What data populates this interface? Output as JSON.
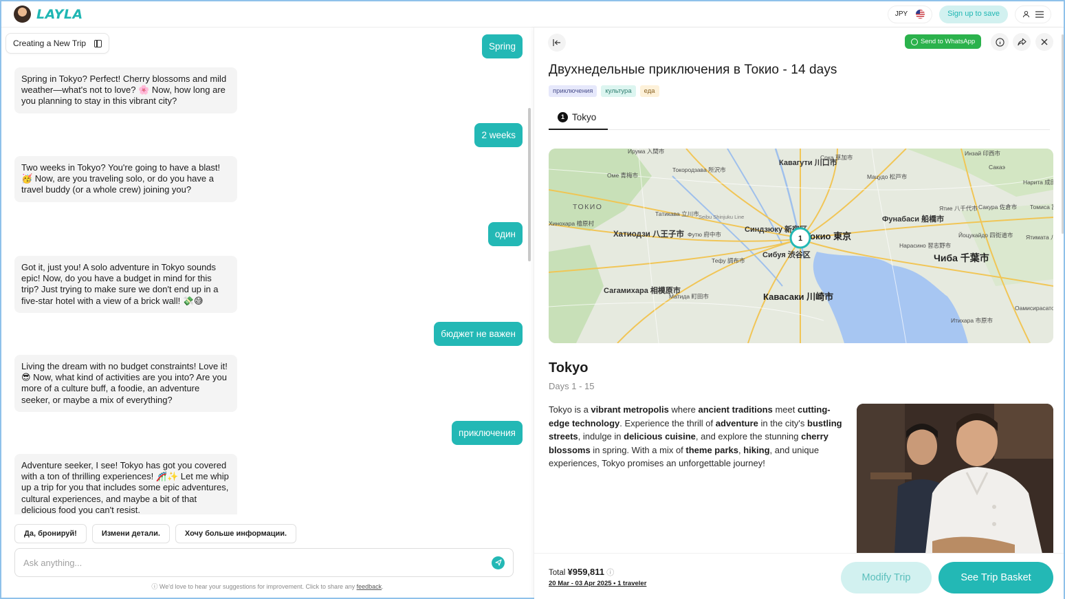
{
  "header": {
    "brand": "LAYLA",
    "currency": "JPY",
    "signup_label": "Sign up to save"
  },
  "chat": {
    "trip_chip_label": "Creating a New Trip",
    "messages": [
      {
        "role": "user",
        "text": "Spring"
      },
      {
        "role": "bot",
        "text": "Spring in Tokyo? Perfect! Cherry blossoms and mild weather—what's not to love? 🌸 Now, how long are you planning to stay in this vibrant city?"
      },
      {
        "role": "user",
        "text": "2 weeks"
      },
      {
        "role": "bot",
        "text": "Two weeks in Tokyo? You're going to have a blast! 🥳 Now, are you traveling solo, or do you have a travel buddy (or a whole crew) joining you?"
      },
      {
        "role": "user",
        "text": "один"
      },
      {
        "role": "bot",
        "text": "Got it, just you! A solo adventure in Tokyo sounds epic! Now, do you have a budget in mind for this trip? Just trying to make sure we don't end up in a five-star hotel with a view of a brick wall! 💸😅"
      },
      {
        "role": "user",
        "text": "бюджет не важен"
      },
      {
        "role": "bot",
        "text": "Living the dream with no budget constraints! Love it! 😎 Now, what kind of activities are you into? Are you more of a culture buff, a foodie, an adventure seeker, or maybe a mix of everything?"
      },
      {
        "role": "user",
        "text": "приключения"
      },
      {
        "role": "bot",
        "text": "Adventure seeker, I see! Tokyo has got you covered with a ton of thrilling experiences! 🎢✨ Let me whip up a trip for you that includes some epic adventures, cultural experiences, and maybe a bit of that delicious food you can't resist."
      }
    ],
    "suggestions": [
      "Да, бронируй!",
      "Измени детали.",
      "Хочу больше информации."
    ],
    "input_placeholder": "Ask anything...",
    "feedback_text": "We'd love to hear your suggestions for improvement. Click to share any",
    "feedback_link": "feedback",
    "feedback_end": "."
  },
  "trip": {
    "whatsapp_label": "Send to WhatsApp",
    "title": "Двухнедельные приключения в Токио - 14 days",
    "tags": [
      {
        "label": "приключения",
        "bg": "#e6e8fb",
        "color": "#4a4f8c"
      },
      {
        "label": "культура",
        "bg": "#dcf5f0",
        "color": "#2c7d6e"
      },
      {
        "label": "еда",
        "bg": "#fdf1d9",
        "color": "#8a6322"
      }
    ],
    "tab_number": "1",
    "tab_label": "Tokyo",
    "map_pin_number": "1",
    "map_labels": [
      "Ирума 入間市",
      "Кавагути 川口市",
      "Сока 草加市",
      "Инзай 印西市",
      "Оме 青梅市",
      "Токородзава 所沢市",
      "Мацудо 松戸市",
      "Сакаэ",
      "Нарита 成田市",
      "ТОКИО",
      "Татикава 立川市",
      "Seibu Shinjuku Line",
      "Фунабаси 船橋市",
      "Ятие 八千代市",
      "Сакура 佐倉市",
      "Томиса 富里市",
      "Хинохара 檜原村",
      "Хатиодзи 八王子市",
      "Футю 府中市",
      "Синдзюку 新宿区",
      "Токио 東京",
      "Нарасино 習志野市",
      "Йоцукайдо 四街道市",
      "Ятимата 八街市",
      "Сибуя 渋谷区",
      "Тефу 調布市",
      "Чиба 千葉市",
      "Сагамихара 相模原市",
      "Матида 町田市",
      "Кавасаки 川崎市",
      "Итихара 市原市",
      "Оамисирасато 大網白里市"
    ],
    "city": "Tokyo",
    "days": "Days 1 - 15",
    "description_parts": [
      {
        "t": "Tokyo is a ",
        "b": false
      },
      {
        "t": "vibrant metropolis",
        "b": true
      },
      {
        "t": " where ",
        "b": false
      },
      {
        "t": "ancient traditions",
        "b": true
      },
      {
        "t": " meet ",
        "b": false
      },
      {
        "t": "cutting-edge technology",
        "b": true
      },
      {
        "t": ". Experience the thrill of ",
        "b": false
      },
      {
        "t": "adventure",
        "b": true
      },
      {
        "t": " in the city's ",
        "b": false
      },
      {
        "t": "bustling streets",
        "b": true
      },
      {
        "t": ", indulge in ",
        "b": false
      },
      {
        "t": "delicious cuisine",
        "b": true
      },
      {
        "t": ", and explore the stunning ",
        "b": false
      },
      {
        "t": "cherry blossoms",
        "b": true
      },
      {
        "t": " in spring. With a mix of ",
        "b": false
      },
      {
        "t": "theme parks",
        "b": true
      },
      {
        "t": ", ",
        "b": false
      },
      {
        "t": "hiking",
        "b": true
      },
      {
        "t": ", and unique experiences, Tokyo promises an unforgettable journey!",
        "b": false
      }
    ],
    "total_label": "Total",
    "total_value": "¥959,811",
    "dates": "20 Mar - 03 Apr 2025 • 1 traveler",
    "modify_label": "Modify Trip",
    "basket_label": "See Trip Basket"
  },
  "colors": {
    "accent": "#23b8b5",
    "accent_light": "#d2f1f0",
    "whatsapp": "#2bb24c"
  }
}
